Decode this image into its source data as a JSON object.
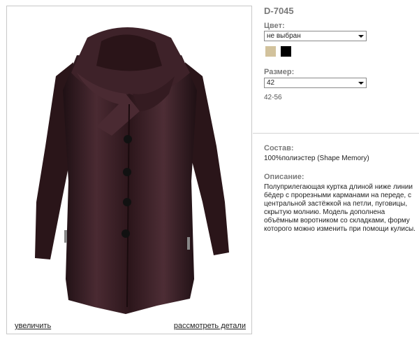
{
  "product": {
    "article": "D-7045",
    "color_label": "Цвет:",
    "color_select": "не выбран",
    "colors": [
      {
        "name": "beige",
        "hex": "#d2c29c"
      },
      {
        "name": "black",
        "hex": "#000000"
      }
    ],
    "size_label": "Размер:",
    "size_select": "42",
    "size_range": "42-56",
    "composition_label": "Состав:",
    "composition": "100%полиэстер (Shape Memory)",
    "description_label": "Описание:",
    "description": "Полуприлегающая куртка длиной ниже линии бёдер с прорезными карманами на переде, с центральной застёжкой на петли, пуговицы, скрытую молнию. Модель дополнена объёмным воротником со складками, форму которого можно изменить при помощи кулисы."
  },
  "photo": {
    "zoom_link": "увеличить",
    "details_link": "рассмотреть детали",
    "jacket_color": "#3a2026",
    "jacket_shade": "#1f1014",
    "jacket_highlight": "#6a4650"
  }
}
